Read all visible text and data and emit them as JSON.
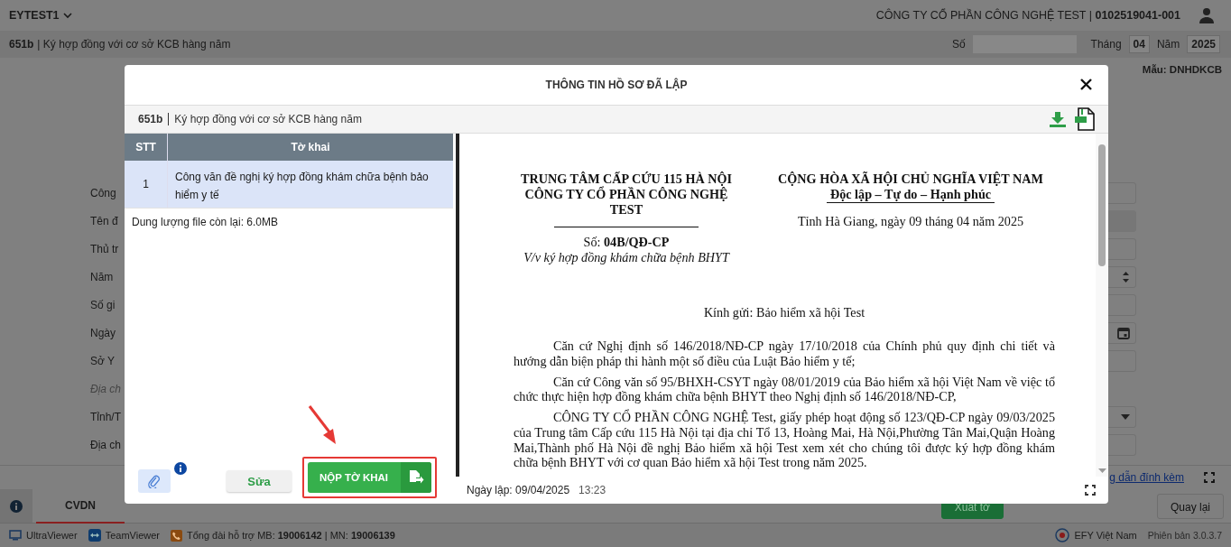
{
  "header": {
    "account": "EYTEST1",
    "company": "CÔNG TY CỔ PHẦN CÔNG NGHỆ TEST | **0102519041-001**"
  },
  "subheader": {
    "code": "651b",
    "title": "| Ký hợp đồng với cơ sở KCB hàng năm",
    "number_label": "Số",
    "month_label": "Tháng",
    "month": "04",
    "year_label": "Năm",
    "year": "2025"
  },
  "template": "Mẫu: DNHDKCB",
  "form_rows": [
    {
      "label": "Công",
      "italic": false,
      "kind": "text"
    },
    {
      "label": "Tên đ",
      "italic": false,
      "kind": "readonly"
    },
    {
      "label": "Thủ tr",
      "italic": false,
      "kind": "text"
    },
    {
      "label": "Năm",
      "italic": false,
      "kind": "spinner"
    },
    {
      "label": "Số gi",
      "italic": false,
      "kind": "text"
    },
    {
      "label": "Ngày",
      "italic": false,
      "kind": "date"
    },
    {
      "label": "Sở Y",
      "italic": false,
      "kind": "text"
    },
    {
      "label": "Địa ch",
      "italic": true,
      "kind": "section"
    },
    {
      "label": "Tỉnh/T",
      "italic": false,
      "kind": "select"
    },
    {
      "label": "Địa ch",
      "italic": false,
      "kind": "text"
    }
  ],
  "guide_link": "g dẫn đính kèm",
  "bottom_tabs": [
    {
      "label": "CVDN",
      "selected": true
    }
  ],
  "action_buttons": [
    {
      "label": "Xuất tờ",
      "kind": "primary"
    },
    {
      "label": "Quay lại",
      "kind": "default"
    }
  ],
  "status_bar": {
    "items": [
      {
        "label": "UltraViewer",
        "kind": "ultraviewer"
      },
      {
        "label": "TeamViewer",
        "kind": "teamviewer"
      },
      {
        "label": "Tổng đài hỗ trợ MB: **19006142** | MN: **19006139**",
        "kind": "phone"
      }
    ],
    "brand": "EFY Việt Nam",
    "version": "Phiên bản 3.0.3.7"
  },
  "modal": {
    "title": "THÔNG TIN HỒ SƠ ĐÃ LẬP",
    "code": "651b",
    "form_title": "Ký hợp đồng với cơ sở KCB hàng năm",
    "table": {
      "columns": [
        "STT",
        "Tờ khai"
      ],
      "rows": [
        {
          "stt": "1",
          "name": "Công văn đề nghị ký hợp đồng khám chữa bệnh bảo hiểm y tế",
          "selected": true
        }
      ]
    },
    "file_quota": "Dung lượng file còn lại: 6.0MB",
    "edit_button": "Sửa",
    "submit_button": "NỘP TỜ KHAI",
    "document": {
      "org_lines": [
        "TRUNG TÂM CẤP CỨU 115 HÀ NỘI",
        "CÔNG TY CỔ PHẦN CÔNG NGHỆ TEST"
      ],
      "number": "Số: **04B/QĐ-CP**",
      "subject": "V/v ký hợp đồng khám chữa bệnh BHYT",
      "nation": "CỘNG HÒA XÃ HỘI CHỦ NGHĨA VIỆT NAM",
      "motto": "Độc lập – Tự do – Hạnh phúc",
      "place_date": "Tỉnh Hà Giang, ngày 09 tháng 04 năm 2025",
      "recipient": "Kính gửi: Bảo hiểm xã hội Test",
      "paragraphs": [
        "Căn cứ Nghị định số 146/2018/NĐ-CP ngày 17/10/2018 của Chính phủ quy định chi tiết và hướng dẫn biện pháp thi hành một số điều của Luật Bảo hiểm y tế;",
        "Căn cứ Công văn số 95/BHXH-CSYT ngày 08/01/2019 của Bảo hiểm xã hội Việt Nam về việc tổ chức thực hiện hợp đồng khám chữa bệnh BHYT theo Nghị định số 146/2018/NĐ-CP,",
        "CÔNG TY CỔ PHẦN CÔNG NGHỆ Test, giấy phép hoạt động số 123/QĐ-CP ngày 09/03/2025 của Trung tâm Cấp cứu 115 Hà Nội tại địa chỉ Tổ 13, Hoàng Mai, Hà Nội,Phường Tân Mai,Quận Hoàng Mai,Thành phố Hà Nội đề nghị Bảo hiểm xã hội Test xem xét cho chúng tôi được ký hợp đồng khám chữa bệnh BHYT với cơ quan Bảo hiểm xã hội Test trong năm 2025."
      ]
    },
    "created_label": "Ngày lập: 09/04/2025",
    "created_time": "13:23"
  }
}
